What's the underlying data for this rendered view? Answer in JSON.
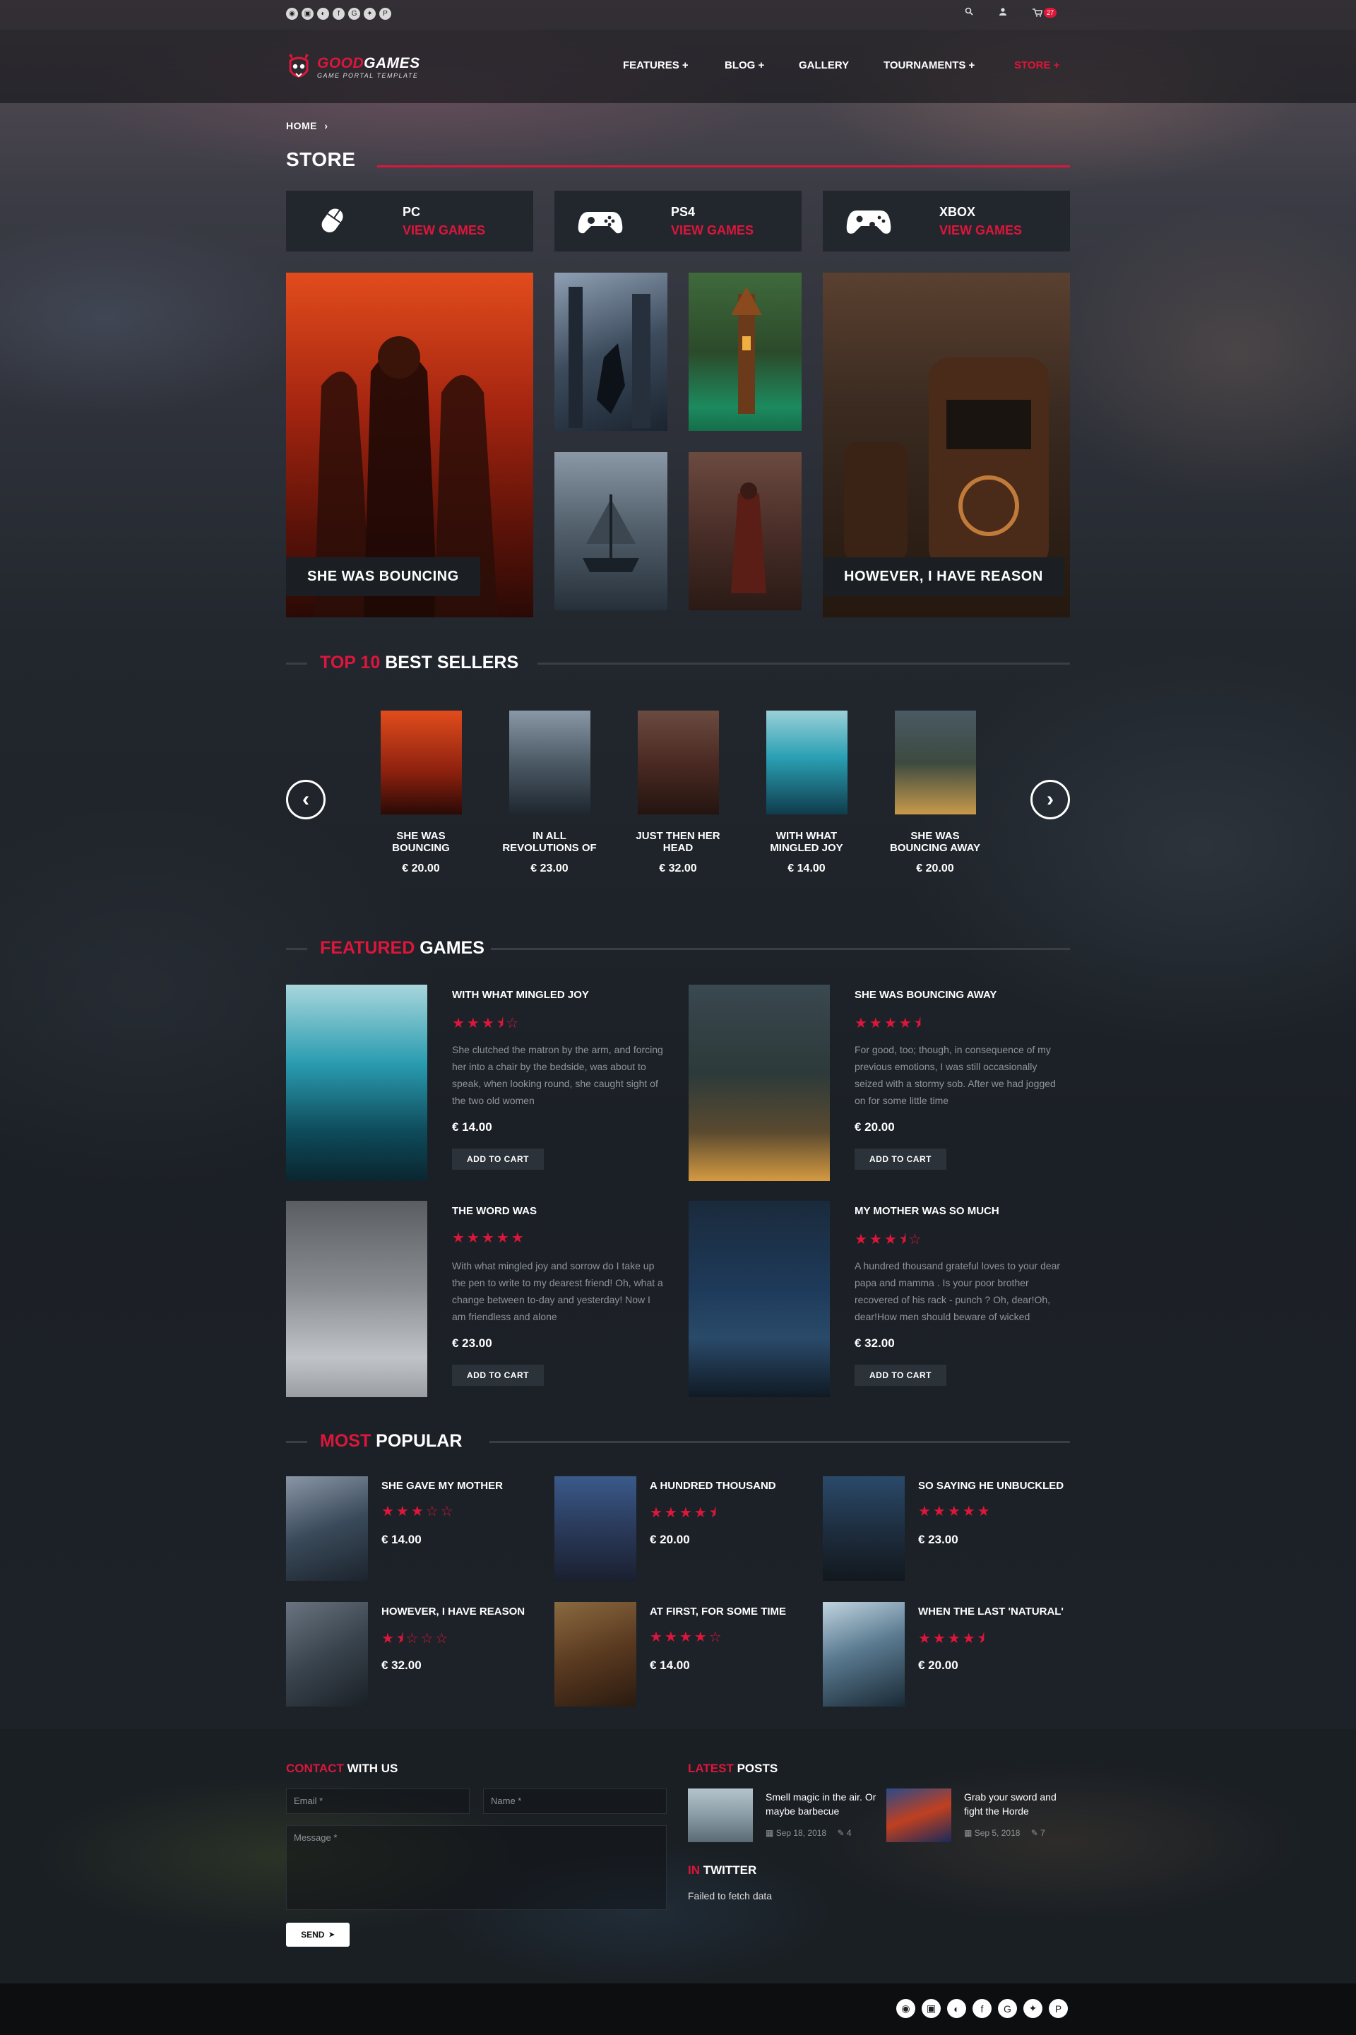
{
  "topbar": {
    "social_icons": [
      "rss-icon",
      "twitch-icon",
      "steam-icon",
      "facebook-icon",
      "google-plus-icon",
      "twitter-icon",
      "pinterest-icon"
    ],
    "social_glyphs": [
      "◉",
      "▣",
      "◐",
      "f",
      "G",
      "✦",
      "P"
    ],
    "cart_count": "27"
  },
  "nav": {
    "logo_part1": "GOOD",
    "logo_part2": "GAMES",
    "logo_tagline": "GAME PORTAL TEMPLATE",
    "menu": {
      "features": "FEATURES +",
      "blog": "BLOG +",
      "gallery": "GALLERY",
      "tournaments": "TOURNAMENTS +",
      "store": "STORE +"
    }
  },
  "breadcrumb": {
    "home": "HOME",
    "sep": "›"
  },
  "page_title": "STORE",
  "platforms": [
    {
      "name": "PC",
      "link": "VIEW GAMES"
    },
    {
      "name": "PS4",
      "link": "VIEW GAMES"
    },
    {
      "name": "XBOX",
      "link": "VIEW GAMES"
    }
  ],
  "hero_tiles": {
    "left_label": "SHE WAS BOUNCING",
    "right_label": "HOWEVER, I HAVE REASON"
  },
  "best_sellers": {
    "title_red": "TOP 10",
    "title_white": "BEST SELLERS",
    "prev": "‹",
    "next": "›",
    "items": [
      {
        "name": "SHE WAS BOUNCING",
        "price": "€ 20.00"
      },
      {
        "name": "IN ALL REVOLUTIONS OF",
        "price": "€ 23.00"
      },
      {
        "name": "JUST THEN HER HEAD",
        "price": "€ 32.00"
      },
      {
        "name": "WITH WHAT MINGLED JOY",
        "price": "€ 14.00"
      },
      {
        "name": "SHE WAS BOUNCING AWAY",
        "price": "€ 20.00"
      }
    ]
  },
  "featured": {
    "title_red": "FEATURED",
    "title_white": "GAMES",
    "cart_label": "ADD TO CART",
    "items": [
      {
        "title": "WITH WHAT MINGLED JOY",
        "rating": 3.5,
        "stars": "★★★⯨☆",
        "desc": "She clutched the matron by the arm, and forcing her into a chair by the bedside, was about to speak, when looking round, she caught sight of the two old women",
        "price": "€ 14.00"
      },
      {
        "title": "SHE WAS BOUNCING AWAY",
        "rating": 4.5,
        "stars": "★★★★⯨",
        "desc": "For good, too; though, in consequence of my previous emotions, I was still occasionally seized with a stormy sob. After we had jogged on for some little time",
        "price": "€ 20.00"
      },
      {
        "title": "THE WORD WAS",
        "rating": 5,
        "stars": "★★★★★",
        "desc": "With what mingled joy and sorrow do I take up the pen to write to my dearest friend! Oh, what a change between to-day and yesterday! Now I am friendless and alone",
        "price": "€ 23.00"
      },
      {
        "title": "MY MOTHER WAS SO MUCH",
        "rating": 3.5,
        "stars": "★★★⯨☆",
        "desc": "A hundred thousand grateful loves to your dear papa and mamma . Is your poor brother recovered of his rack - punch ? Oh, dear!Oh, dear!How men should beware of wicked",
        "price": "€ 32.00"
      }
    ]
  },
  "popular": {
    "title_red": "MOST",
    "title_white": "POPULAR",
    "items": [
      {
        "title": "SHE GAVE MY MOTHER",
        "rating": 3,
        "stars": "★★★☆☆",
        "price": "€ 14.00"
      },
      {
        "title": "A HUNDRED THOUSAND",
        "rating": 4.5,
        "stars": "★★★★⯨",
        "price": "€ 20.00"
      },
      {
        "title": "SO SAYING HE UNBUCKLED",
        "rating": 5,
        "stars": "★★★★★",
        "price": "€ 23.00"
      },
      {
        "title": "HOWEVER, I HAVE REASON",
        "rating": 1.5,
        "stars": "★⯨☆☆☆",
        "price": "€ 32.00"
      },
      {
        "title": "AT FIRST, FOR SOME TIME",
        "rating": 4,
        "stars": "★★★★☆",
        "price": "€ 14.00"
      },
      {
        "title": "WHEN THE LAST 'NATURAL'",
        "rating": 4.5,
        "stars": "★★★★⯨",
        "price": "€ 20.00"
      }
    ]
  },
  "contact": {
    "title_red": "CONTACT",
    "title_white": "WITH US",
    "email_placeholder": "Email *",
    "name_placeholder": "Name *",
    "message_placeholder": "Message *",
    "send_label": "SEND"
  },
  "latest_posts": {
    "title_red": "LATEST",
    "title_white": "POSTS",
    "items": [
      {
        "title": "Smell magic in the air. Or maybe barbecue",
        "date": "Sep 18, 2018",
        "comments": "4"
      },
      {
        "title": "Grab your sword and fight the Horde",
        "date": "Sep 5, 2018",
        "comments": "7"
      }
    ]
  },
  "twitter": {
    "title_red": "IN",
    "title_white": "TWITTER",
    "message": "Failed to fetch data"
  },
  "footer": {
    "social_icons": [
      "rss-icon",
      "twitch-icon",
      "steam-icon",
      "facebook-icon",
      "google-plus-icon",
      "twitter-icon",
      "pinterest-icon"
    ],
    "social_glyphs": [
      "◉",
      "▣",
      "◐",
      "f",
      "G",
      "✦",
      "P"
    ]
  },
  "colors": {
    "accent": "#dd163b",
    "panel": "#22272e",
    "bg": "#181c21"
  }
}
